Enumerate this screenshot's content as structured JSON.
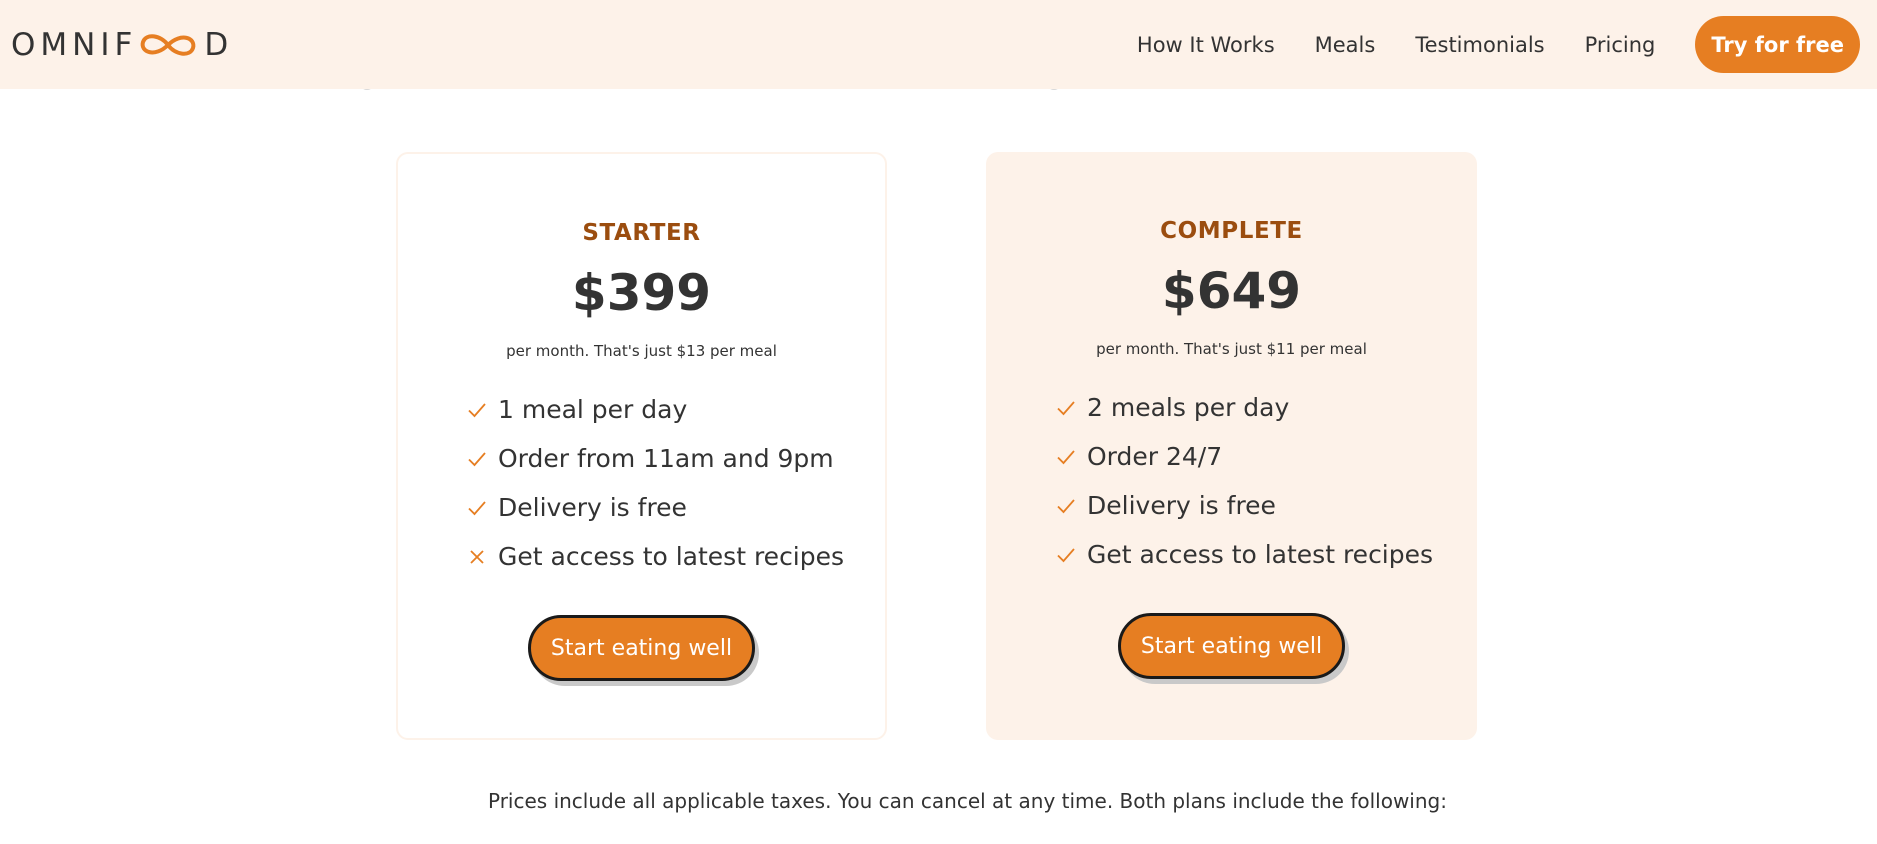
{
  "header": {
    "logo_text_left": "OMNIF",
    "logo_text_right": "D",
    "nav": [
      {
        "label": "How It Works"
      },
      {
        "label": "Meals"
      },
      {
        "label": "Testimonials"
      },
      {
        "label": "Pricing"
      }
    ],
    "cta_label": "Try for free"
  },
  "plans": [
    {
      "name": "STARTER",
      "price": "$399",
      "subtitle": "per month. That's just $13 per meal",
      "features": [
        {
          "text": "1 meal per day",
          "icon": "check-icon"
        },
        {
          "text": "Order from 11am and 9pm",
          "icon": "check-icon"
        },
        {
          "text": "Delivery is free",
          "icon": "check-icon"
        },
        {
          "text": "Get access to latest recipes",
          "icon": "close-icon"
        }
      ],
      "cta_label": "Start eating well"
    },
    {
      "name": "COMPLETE",
      "price": "$649",
      "subtitle": "per month. That's just $11 per meal",
      "features": [
        {
          "text": "2 meals per day",
          "icon": "check-icon"
        },
        {
          "text": "Order 24/7",
          "icon": "check-icon"
        },
        {
          "text": "Delivery is free",
          "icon": "check-icon"
        },
        {
          "text": "Get access to latest recipes",
          "icon": "check-icon"
        }
      ],
      "cta_label": "Start eating well"
    }
  ],
  "footnote": "Prices include all applicable taxes. You can cancel at any time. Both plans include the following:",
  "colors": {
    "accent": "#e67e22",
    "header_bg": "#fdf2e9",
    "plan_name": "#9b4d0f",
    "text": "#333333"
  }
}
